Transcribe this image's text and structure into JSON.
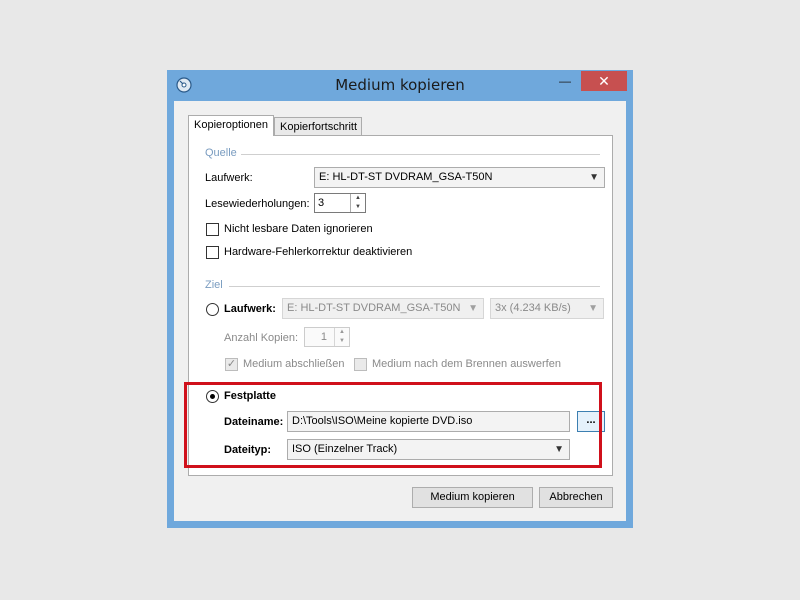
{
  "window": {
    "title": "Medium kopieren"
  },
  "tabs": [
    {
      "label": "Kopieroptionen"
    },
    {
      "label": "Kopierfortschritt"
    }
  ],
  "source": {
    "group_label": "Quelle",
    "drive_label": "Laufwerk:",
    "drive_value": "E: HL-DT-ST DVDRAM_GSA-T50N",
    "retries_label": "Lesewiederholungen:",
    "retries_value": "3",
    "ignore_label": "Nicht lesbare Daten ignorieren",
    "hwfix_label": "Hardware-Fehlerkorrektur deaktivieren"
  },
  "target": {
    "group_label": "Ziel",
    "drive_label": "Laufwerk:",
    "drive_value": "E: HL-DT-ST DVDRAM_GSA-T50N",
    "speed_value": "3x (4.234 KB/s)",
    "copies_label": "Anzahl Kopien:",
    "copies_value": "1",
    "finalize_label": "Medium abschließen",
    "eject_label": "Medium nach dem Brennen auswerfen",
    "disk_label": "Festplatte",
    "filename_label": "Dateiname:",
    "filename_value": "D:\\Tools\\ISO\\Meine kopierte DVD.iso",
    "browse_label": "...",
    "filetype_label": "Dateityp:",
    "filetype_value": "ISO (Einzelner Track)"
  },
  "buttons": {
    "copy": "Medium kopieren",
    "cancel": "Abbrechen"
  },
  "colors": {
    "highlight": "#d0101b",
    "close_button": "#c75050",
    "window_frame": "#6fa8dc"
  }
}
